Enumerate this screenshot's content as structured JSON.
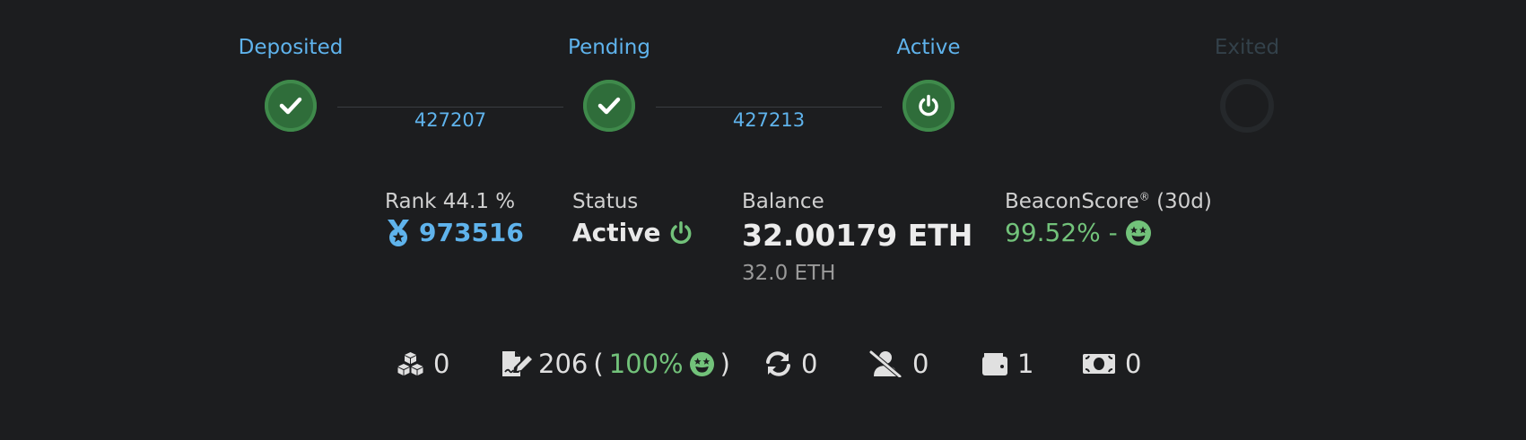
{
  "timeline": {
    "steps": [
      {
        "label": "Deposited",
        "state": "done",
        "icon": "check-icon"
      },
      {
        "label": "Pending",
        "state": "done",
        "icon": "check-icon"
      },
      {
        "label": "Active",
        "state": "active",
        "icon": "power-icon"
      },
      {
        "label": "Exited",
        "state": "inactive",
        "icon": "empty-circle-icon"
      }
    ],
    "epochs": [
      "427207",
      "427213"
    ]
  },
  "stats": {
    "rank": {
      "label": "Rank 44.1 %",
      "value": "973516",
      "icon": "medal-icon"
    },
    "status": {
      "label": "Status",
      "value": "Active",
      "icon": "power-icon"
    },
    "balance": {
      "label": "Balance",
      "value": "32.00179 ETH",
      "effective": "32.0 ETH"
    },
    "score": {
      "label": "BeaconScore",
      "mark": "®",
      "period": "(30d)",
      "value": "99.52% -",
      "icon": "grin-stars-icon"
    }
  },
  "counters": {
    "blocks": {
      "icon": "cubes-icon",
      "value": "0"
    },
    "attestations": {
      "icon": "file-signature-icon",
      "value": "206",
      "open": "(",
      "percent": "100%",
      "close": ")",
      "face_icon": "grin-stars-icon"
    },
    "sync": {
      "icon": "sync-icon",
      "value": "0"
    },
    "slashed": {
      "icon": "user-slash-icon",
      "value": "0"
    },
    "deposits": {
      "icon": "wallet-icon",
      "value": "1"
    },
    "withdrawals": {
      "icon": "money-bill-icon",
      "value": "0"
    }
  },
  "colors": {
    "accent": "#5fb3ec",
    "success": "#72c27a",
    "background": "#1c1d1f"
  }
}
